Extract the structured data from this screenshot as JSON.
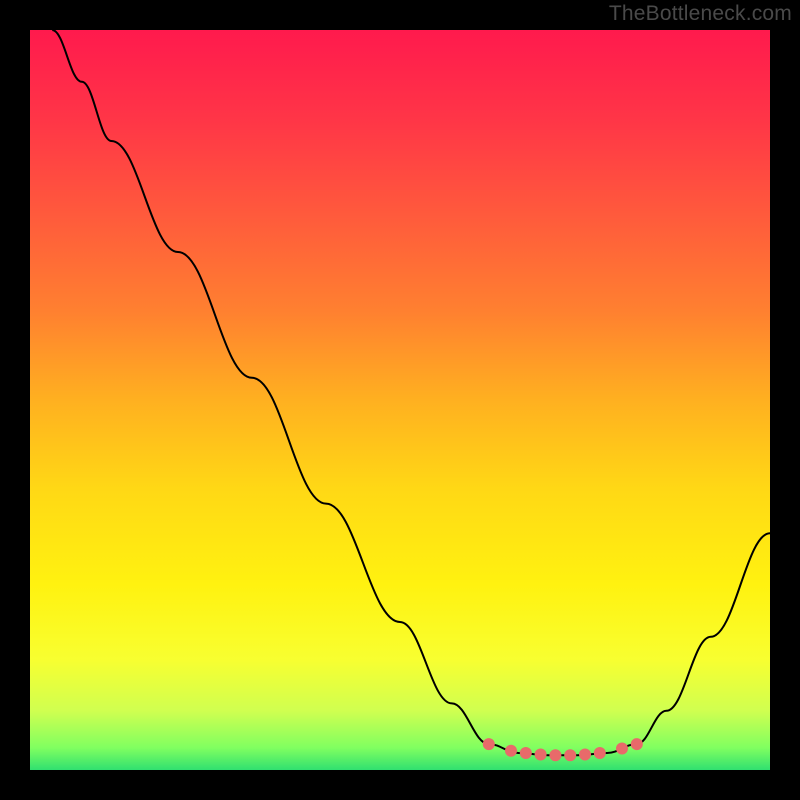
{
  "watermark": "TheBottleneck.com",
  "chart_data": {
    "type": "line",
    "title": "",
    "xlabel": "",
    "ylabel": "",
    "xlim": [
      0,
      100
    ],
    "ylim": [
      0,
      100
    ],
    "background": {
      "type": "vertical-gradient",
      "stops": [
        {
          "offset": 0.0,
          "color": "#ff1a4d"
        },
        {
          "offset": 0.12,
          "color": "#ff3547"
        },
        {
          "offset": 0.25,
          "color": "#ff5a3c"
        },
        {
          "offset": 0.38,
          "color": "#ff8030"
        },
        {
          "offset": 0.5,
          "color": "#ffb020"
        },
        {
          "offset": 0.62,
          "color": "#ffd815"
        },
        {
          "offset": 0.75,
          "color": "#fff210"
        },
        {
          "offset": 0.85,
          "color": "#f8ff30"
        },
        {
          "offset": 0.92,
          "color": "#d0ff50"
        },
        {
          "offset": 0.97,
          "color": "#80ff60"
        },
        {
          "offset": 1.0,
          "color": "#30e070"
        }
      ]
    },
    "series": [
      {
        "name": "curve",
        "color": "#000000",
        "width": 2,
        "points": [
          {
            "x": 3,
            "y": 100
          },
          {
            "x": 7,
            "y": 93
          },
          {
            "x": 11,
            "y": 85
          },
          {
            "x": 20,
            "y": 70
          },
          {
            "x": 30,
            "y": 53
          },
          {
            "x": 40,
            "y": 36
          },
          {
            "x": 50,
            "y": 20
          },
          {
            "x": 57,
            "y": 9
          },
          {
            "x": 62,
            "y": 3.5
          },
          {
            "x": 66,
            "y": 2.3
          },
          {
            "x": 70,
            "y": 2.0
          },
          {
            "x": 74,
            "y": 2.0
          },
          {
            "x": 78,
            "y": 2.3
          },
          {
            "x": 82,
            "y": 3.5
          },
          {
            "x": 86,
            "y": 8
          },
          {
            "x": 92,
            "y": 18
          },
          {
            "x": 100,
            "y": 32
          }
        ]
      }
    ],
    "markers": {
      "name": "valley-markers",
      "color": "#e86a6a",
      "radius": 6,
      "points": [
        {
          "x": 62,
          "y": 3.5
        },
        {
          "x": 65,
          "y": 2.6
        },
        {
          "x": 67,
          "y": 2.3
        },
        {
          "x": 69,
          "y": 2.1
        },
        {
          "x": 71,
          "y": 2.0
        },
        {
          "x": 73,
          "y": 2.0
        },
        {
          "x": 75,
          "y": 2.1
        },
        {
          "x": 77,
          "y": 2.3
        },
        {
          "x": 80,
          "y": 2.9
        },
        {
          "x": 82,
          "y": 3.5
        }
      ]
    }
  }
}
